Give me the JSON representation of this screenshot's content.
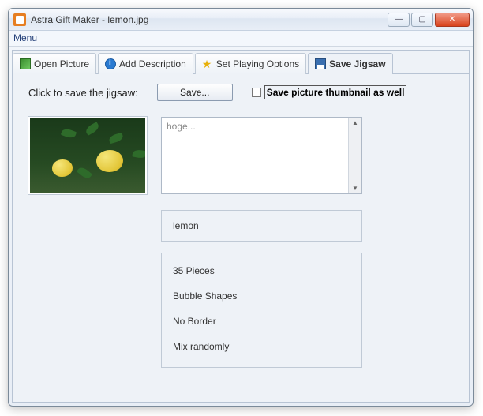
{
  "window": {
    "title": "Astra Gift Maker - lemon.jpg"
  },
  "menubar": {
    "menu_label": "Menu"
  },
  "tabs": {
    "open_picture": "Open Picture",
    "add_description": "Add Description",
    "set_playing_options": "Set Playing Options",
    "save_jigsaw": "Save Jigsaw"
  },
  "save_pane": {
    "instruction": "Click to save the jigsaw:",
    "save_button": "Save...",
    "checkbox_label": "Save picture thumbnail as well"
  },
  "description": {
    "placeholder": "hoge..."
  },
  "jigsaw": {
    "name": "lemon",
    "options": {
      "pieces": "35 Pieces",
      "shapes": "Bubble Shapes",
      "border": "No Border",
      "mix": "Mix randomly"
    }
  }
}
